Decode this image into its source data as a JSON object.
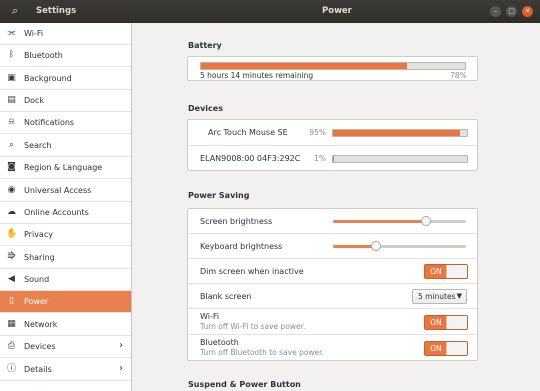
{
  "titlebar": {
    "settings_title": "Settings",
    "panel_title": "Power",
    "search_icon": "search-icon"
  },
  "sidebar": {
    "items": [
      {
        "label": "Wi-Fi",
        "icon": "wifi-icon"
      },
      {
        "label": "Bluetooth",
        "icon": "bluetooth-icon"
      },
      {
        "label": "Background",
        "icon": "background-icon"
      },
      {
        "label": "Dock",
        "icon": "dock-icon"
      },
      {
        "label": "Notifications",
        "icon": "bell-icon"
      },
      {
        "label": "Search",
        "icon": "search-icon"
      },
      {
        "label": "Region & Language",
        "icon": "camera-icon"
      },
      {
        "label": "Universal Access",
        "icon": "accessibility-icon"
      },
      {
        "label": "Online Accounts",
        "icon": "cloud-icon"
      },
      {
        "label": "Privacy",
        "icon": "hand-icon"
      },
      {
        "label": "Sharing",
        "icon": "share-icon"
      },
      {
        "label": "Sound",
        "icon": "speaker-icon"
      },
      {
        "label": "Power",
        "icon": "battery-icon"
      },
      {
        "label": "Network",
        "icon": "network-icon"
      },
      {
        "label": "Devices",
        "icon": "printer-icon"
      },
      {
        "label": "Details",
        "icon": "info-icon"
      }
    ],
    "active_index": 12
  },
  "battery": {
    "section_title": "Battery",
    "remaining": "5 hours 14 minutes remaining",
    "percent_text": "78%",
    "level": 0.78
  },
  "devices": {
    "section_title": "Devices",
    "items": [
      {
        "name": "Arc Touch Mouse SE",
        "percent_text": "95%",
        "level": 0.95
      },
      {
        "name": "ELAN9008:00 04F3:292C",
        "percent_text": "1%",
        "level": 0.01
      }
    ]
  },
  "power_saving": {
    "section_title": "Power Saving",
    "screen_brightness": {
      "label": "Screen brightness",
      "level": 0.7
    },
    "keyboard_brightness": {
      "label": "Keyboard brightness",
      "level": 0.32
    },
    "dim_screen": {
      "label": "Dim screen when inactive",
      "state": "ON"
    },
    "blank_screen": {
      "label": "Blank screen",
      "value": "5 minutes"
    },
    "wifi": {
      "label": "Wi-Fi",
      "sublabel": "Turn off Wi-Fi to save power.",
      "state": "ON"
    },
    "bluetooth": {
      "label": "Bluetooth",
      "sublabel": "Turn off Bluetooth to save power.",
      "state": "ON"
    }
  },
  "suspend": {
    "section_title": "Suspend & Power Button"
  },
  "colors": {
    "accent": "#e9773f",
    "titlebar": "#3c3b37",
    "close_button": "#dd5a2a"
  }
}
